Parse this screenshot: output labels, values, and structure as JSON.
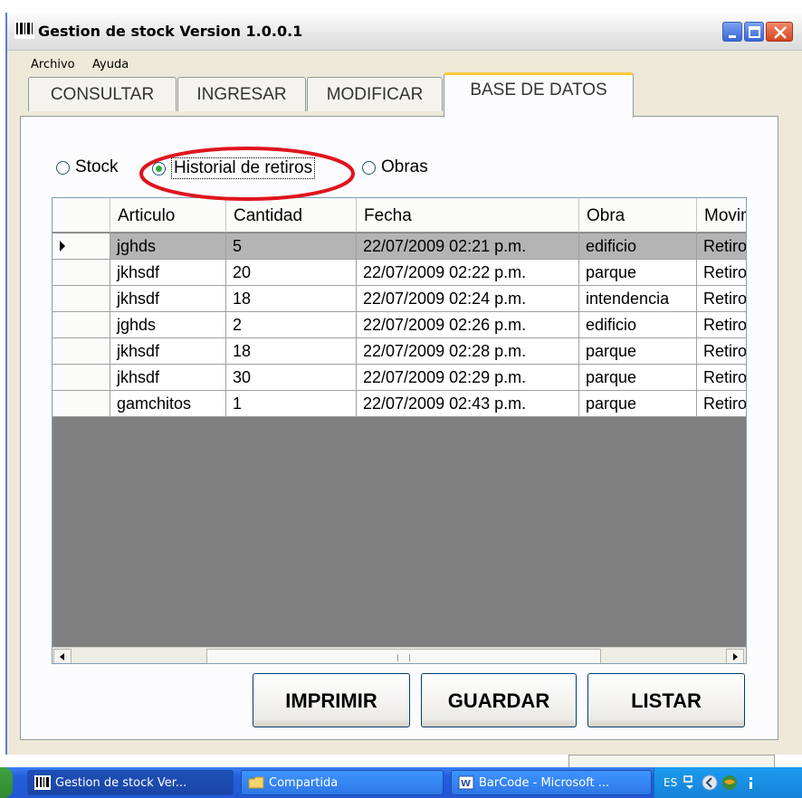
{
  "window": {
    "title": "Gestion de stock Version 1.0.0.1"
  },
  "menu": {
    "items": [
      "Archivo",
      "Ayuda"
    ]
  },
  "tabs": [
    {
      "label": "CONSULTAR",
      "active": false
    },
    {
      "label": "INGRESAR",
      "active": false
    },
    {
      "label": "MODIFICAR",
      "active": false
    },
    {
      "label": "BASE DE DATOS",
      "active": true
    }
  ],
  "radios": [
    {
      "label": "Stock",
      "checked": false
    },
    {
      "label": "Historial de retiros",
      "checked": true
    },
    {
      "label": "Obras",
      "checked": false
    }
  ],
  "grid": {
    "columns": [
      "Articulo",
      "Cantidad",
      "Fecha",
      "Obra",
      "Movimiento"
    ],
    "rows": [
      [
        "jghds",
        "5",
        "22/07/2009 02:21 p.m.",
        "edificio",
        "Retiro"
      ],
      [
        "jkhsdf",
        "20",
        "22/07/2009 02:22 p.m.",
        "parque",
        "Retiro"
      ],
      [
        "jkhsdf",
        "18",
        "22/07/2009 02:24 p.m.",
        "intendencia",
        "Retiro"
      ],
      [
        "jghds",
        "2",
        "22/07/2009 02:26 p.m.",
        "edificio",
        "Retiro"
      ],
      [
        "jkhsdf",
        "18",
        "22/07/2009 02:28 p.m.",
        "parque",
        "Retiro"
      ],
      [
        "jkhsdf",
        "30",
        "22/07/2009 02:29 p.m.",
        "parque",
        "Retiro"
      ],
      [
        "gamchitos",
        "1",
        "22/07/2009 02:43 p.m.",
        "parque",
        "Retiro"
      ]
    ],
    "selected_row": 0
  },
  "buttons": {
    "imprimir": "IMPRIMIR",
    "guardar": "GUARDAR",
    "listar": "LISTAR"
  },
  "taskbar": {
    "items": [
      "Gestion de stock Ver...",
      "Compartida",
      "BarCode - Microsoft ..."
    ],
    "tray_language": "ES"
  },
  "colors": {
    "highlight_ellipse": "#e0141e",
    "selected_row": "#b4b4b4",
    "grid_background": "#808080",
    "taskbar": "#245edb"
  }
}
